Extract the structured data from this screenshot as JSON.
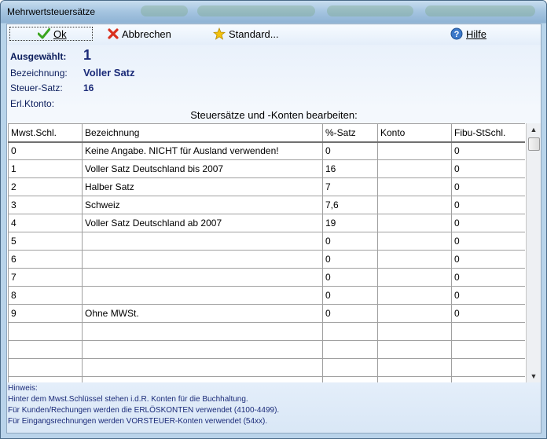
{
  "window": {
    "title": "Mehrwertsteuersätze"
  },
  "toolbar": {
    "ok_label": "Ok",
    "cancel_label": "Abbrechen",
    "standard_label": "Standard...",
    "help_label": "Hilfe"
  },
  "info": {
    "selected_label": "Ausgewählt:",
    "selected_value": "1",
    "name_label": "Bezeichnung:",
    "name_value": "Voller Satz",
    "rate_label": "Steuer-Satz:",
    "rate_value": "16",
    "account_label": "Erl.Ktonto:",
    "account_value": ""
  },
  "grid": {
    "title": "Steuersätze und -Konten bearbeiten:",
    "columns": [
      "Mwst.Schl.",
      "Bezeichnung",
      "%-Satz",
      "Konto",
      "Fibu-StSchl."
    ],
    "rows": [
      [
        "0",
        "Keine Angabe. NICHT für Ausland verwenden!",
        "0",
        "",
        "0"
      ],
      [
        "1",
        "Voller Satz Deutschland bis 2007",
        "16",
        "",
        "0"
      ],
      [
        "2",
        "Halber Satz",
        "7",
        "",
        "0"
      ],
      [
        "3",
        "Schweiz",
        "7,6",
        "",
        "0"
      ],
      [
        "4",
        "Voller Satz Deutschland ab 2007",
        "19",
        "",
        "0"
      ],
      [
        "5",
        "",
        "0",
        "",
        "0"
      ],
      [
        "6",
        "",
        "0",
        "",
        "0"
      ],
      [
        "7",
        "",
        "0",
        "",
        "0"
      ],
      [
        "8",
        "",
        "0",
        "",
        "0"
      ],
      [
        "9",
        "Ohne MWSt.",
        "0",
        "",
        "0"
      ],
      [
        "",
        "",
        "",
        "",
        ""
      ],
      [
        "",
        "",
        "",
        "",
        ""
      ],
      [
        "",
        "",
        "",
        "",
        ""
      ],
      [
        "",
        "",
        "",
        "",
        ""
      ]
    ]
  },
  "hint": {
    "heading": "Hinweis:",
    "lines": [
      "Hinter dem Mwst.Schlüssel stehen i.d.R. Konten für die Buchhaltung.",
      "Für Kunden/Rechungen werden die ERLÖSKONTEN verwendet (4100-4499).",
      "Für Eingangsrechnungen werden VORSTEUER-Konten verwendet (54xx)."
    ]
  },
  "colors": {
    "accent_text": "#1a2a78",
    "ok_icon": "#3aa51f",
    "cancel_icon": "#d9301e",
    "star_icon": "#f4c20d",
    "help_icon": "#3b78c9"
  },
  "icons": {
    "ok": "checkmark-icon",
    "cancel": "x-icon",
    "standard": "star-icon",
    "help": "question-circle-icon"
  }
}
